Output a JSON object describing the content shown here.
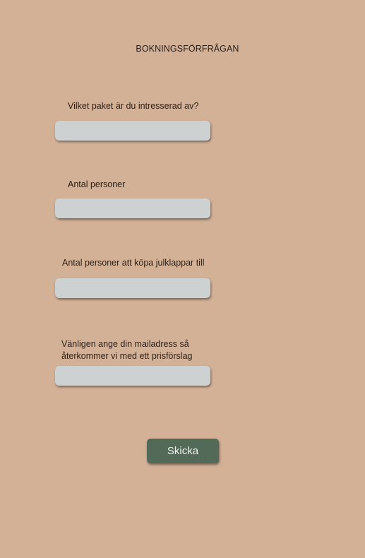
{
  "form": {
    "title": "BOKNINGSFÖRFRÅGAN",
    "fields": [
      {
        "label": "Vilket paket är du intresserad av?",
        "value": ""
      },
      {
        "label": "Antal personer",
        "value": ""
      },
      {
        "label": "Antal personer att köpa julklappar till",
        "value": ""
      },
      {
        "label_line1": "Vänligen ange din mailadress så",
        "label_line2": "återkommer vi med ett prisförslag",
        "value": ""
      }
    ],
    "submit_label": "Skicka"
  },
  "colors": {
    "background": "#d3b197",
    "input_background": "#cdd1d1",
    "button_background": "#546a59",
    "button_text": "#eef0ec"
  }
}
